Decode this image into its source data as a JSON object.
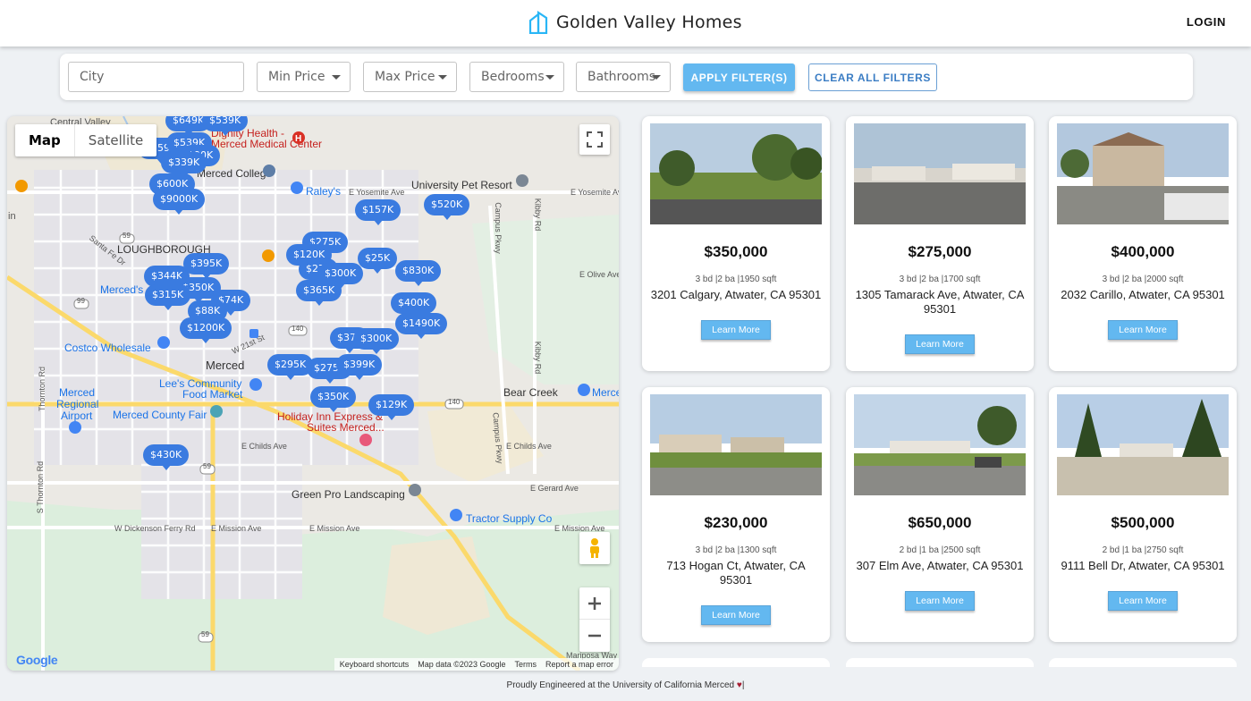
{
  "header": {
    "brand_name": "Golden Valley Homes",
    "login_label": "LOGIN",
    "brand_icon": "house-outline-icon"
  },
  "filters": {
    "city_placeholder": "City",
    "min_price_label": "Min Price",
    "max_price_label": "Max Price",
    "bedrooms_label": "Bedrooms",
    "bathrooms_label": "Bathrooms",
    "apply_label": "APPLY FILTER(S)",
    "clear_label": "CLEAR ALL FILTERS"
  },
  "map": {
    "type_map": "Map",
    "type_satellite": "Satellite",
    "attribution": [
      "Keyboard shortcuts",
      "Map data ©2023 Google",
      "Terms",
      "Report a map error"
    ],
    "google_logo": "Google",
    "labels": {
      "central_valley": "Central Valley",
      "dignity_health": "Dignity Health -",
      "merced_medical": "Merced Medical Center",
      "merced_college": "Merced College",
      "raleys": "Raley's",
      "university_pet_resort": "University Pet Resort",
      "e_yosemite_ave_1": "E Yosemite Ave",
      "e_yosemite_ave_2": "E Yosemite Ave",
      "loughborough": "LOUGHBOROUGH",
      "santa_fe_dr": "Santa Fe Dr",
      "merced_s": "Merced's",
      "costco": "Costco Wholesale",
      "merced": "Merced",
      "lees_community": "Lee's Community",
      "food_market": "Food Market",
      "merced_regional_1": "Merced",
      "merced_regional_2": "Regional",
      "merced_regional_3": "Airport",
      "merced_county_fair": "Merced County Fair",
      "holiday_inn_1": "Holiday Inn Express &",
      "holiday_inn_2": "Suites Merced...",
      "bear_creek": "Bear Creek",
      "merce": "Merce",
      "e_childs_ave_1": "E Childs Ave",
      "e_childs_ave_2": "E Childs Ave",
      "green_pro": "Green Pro Landscaping",
      "tractor_supply": "Tractor Supply Co",
      "e_gerard_ave": "E Gerard Ave",
      "w_dickenson": "W Dickenson Ferry Rd",
      "e_mission_ave_1": "E Mission Ave",
      "e_mission_ave_2": "E Mission Ave",
      "e_mission_ave_3": "E Mission Ave",
      "campus_pkwy_1": "Campus Pkwy",
      "campus_pkwy_2": "Campus Pkwy",
      "kibby_rd_1": "Kibby Rd",
      "kibby_rd_2": "Kibby Rd",
      "e_olive_ave": "E Olive Ave",
      "w_21st": "W 21st St",
      "mariposa_way": "Mariposa Way",
      "thornton_rd": "Thornton Rd",
      "s_thornton_rd": "S Thornton Rd",
      "shield_59_1": "59",
      "shield_59_2": "59",
      "shield_59_3": "59",
      "shield_99": "99",
      "shield_140_1": "140",
      "shield_140_2": "140",
      "in": "in"
    },
    "pins": [
      "$649K",
      "$559K",
      "$539K",
      "$90K",
      "$339K",
      "$600K",
      "$9000K",
      "$157K",
      "$520K",
      "$275K",
      "$120K",
      "$25K",
      "$27K",
      "$300K",
      "$830K",
      "$344K",
      "$395K",
      "$350K",
      "$315K",
      "$365K",
      "$74K",
      "$400K",
      "$88K",
      "$1490K",
      "$1200K",
      "$37K",
      "$300K",
      "$295K",
      "$275K",
      "$399K",
      "$350K",
      "$129K",
      "$430K"
    ]
  },
  "listings": [
    {
      "price": "$350,000",
      "specs": "3 bd |2 ba |1950 sqft",
      "address": "3201 Calgary, Atwater, CA 95301",
      "cta": "Learn More"
    },
    {
      "price": "$275,000",
      "specs": "3 bd |2 ba |1700 sqft",
      "address": "1305 Tamarack Ave, Atwater, CA 95301",
      "cta": "Learn More"
    },
    {
      "price": "$400,000",
      "specs": "3 bd |2 ba |2000 sqft",
      "address": "2032 Carillo, Atwater, CA 95301",
      "cta": "Learn More"
    },
    {
      "price": "$230,000",
      "specs": "3 bd |2 ba |1300 sqft",
      "address": "713 Hogan Ct, Atwater, CA 95301",
      "cta": "Learn More"
    },
    {
      "price": "$650,000",
      "specs": "2 bd |1 ba |2500 sqft",
      "address": "307 Elm Ave, Atwater, CA 95301",
      "cta": "Learn More"
    },
    {
      "price": "$500,000",
      "specs": "2 bd |1 ba |2750 sqft",
      "address": "9111 Bell Dr, Atwater, CA 95301",
      "cta": "Learn More"
    }
  ],
  "footer": {
    "text": "Proudly Engineered at the University of California Merced",
    "heart": "♥",
    "bar": "|"
  },
  "colors": {
    "accent": "#63b8f0",
    "pin": "#3a7be0",
    "clear_border": "#6a9fd4",
    "heart": "#a51c30"
  }
}
